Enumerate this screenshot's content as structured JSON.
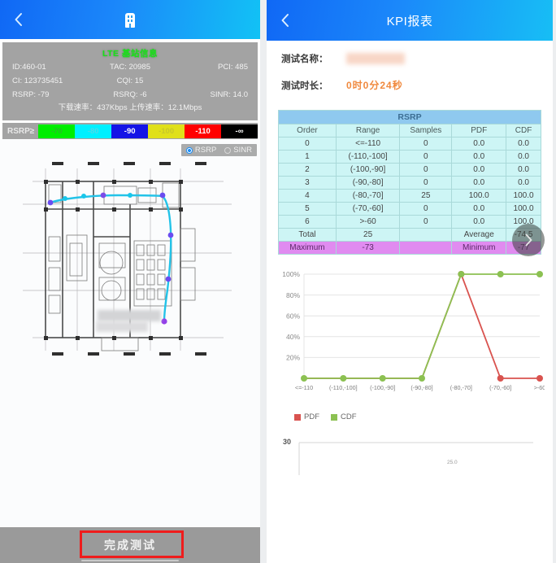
{
  "left": {
    "navbar": {
      "back_icon": "chevron-left-icon",
      "center_icon": "base-station-icon"
    },
    "cell_info": {
      "title": "LTE 基站信息",
      "id_label": "ID:460-01",
      "tac_label": "TAC: 20985",
      "pci_label": "PCI: 485",
      "ci_label": "CI: 123735451",
      "cqi_label": "CQI: 15",
      "blank_label": "",
      "rsrp_label": "RSRP: -79",
      "rsrq_label": "RSRQ: -6",
      "sinr_label": "SINR: 14.0",
      "rates_label": "下载速率：437Kbps 上传速率：12.1Mbps"
    },
    "legend": {
      "label": "RSRP≥",
      "cells": [
        {
          "text": "-70",
          "bg": "#00ee00",
          "fg": "#2bb82b"
        },
        {
          "text": "-80",
          "bg": "#00f0ff",
          "fg": "#4fd8e8"
        },
        {
          "text": "-90",
          "bg": "#1414e6",
          "fg": "#ffffff"
        },
        {
          "text": "-100",
          "bg": "#e0e01a",
          "fg": "#c8c82a"
        },
        {
          "text": "-110",
          "bg": "#ff0000",
          "fg": "#ffffff"
        },
        {
          "text": "-∞",
          "bg": "#000000",
          "fg": "#ffffff"
        }
      ]
    },
    "overlay_toggle": {
      "rsrp_label": "RSRP",
      "sinr_label": "SINR",
      "selected": "RSRP"
    },
    "map": {
      "scroll_hint": ""
    },
    "bottom": {
      "finish_label": "完成测试"
    }
  },
  "right": {
    "navbar": {
      "back_icon": "chevron-left-icon",
      "title": "KPI报表"
    },
    "meta": {
      "name_label": "测试名称：",
      "name_value": "",
      "duration_label": "测试时长：",
      "duration_value": "0时0分24秒"
    },
    "table": {
      "title": "RSRP",
      "headers": [
        "Order",
        "Range",
        "Samples",
        "PDF",
        "CDF"
      ],
      "rows": [
        [
          "0",
          "<=-110",
          "0",
          "0.0",
          "0.0"
        ],
        [
          "1",
          "(-110,-100]",
          "0",
          "0.0",
          "0.0"
        ],
        [
          "2",
          "(-100,-90]",
          "0",
          "0.0",
          "0.0"
        ],
        [
          "3",
          "(-90,-80]",
          "0",
          "0.0",
          "0.0"
        ],
        [
          "4",
          "(-80,-70]",
          "25",
          "100.0",
          "100.0"
        ],
        [
          "5",
          "(-70,-60]",
          "0",
          "0.0",
          "100.0"
        ],
        [
          "6",
          ">-60",
          "0",
          "0.0",
          "100.0"
        ]
      ],
      "summary": [
        "Total",
        "25",
        "",
        "Average",
        "-74.5"
      ],
      "minmax": [
        "Maximum",
        "-73",
        "",
        "Minimum",
        "-77"
      ]
    },
    "fab": {
      "icon": "chevron-right-icon"
    },
    "chart2": {
      "ytick": "30",
      "point_label": "25.0"
    }
  },
  "chart_data": {
    "type": "line",
    "title": "",
    "xlabel": "",
    "ylabel": "",
    "categories": [
      "<=-110",
      "(-110,-100]",
      "(-100,-90]",
      "(-90,-80]",
      "(-80,-70]",
      "(-70,-60]",
      ">-60"
    ],
    "series": [
      {
        "name": "PDF",
        "color": "#d9534f",
        "values": [
          0,
          0,
          0,
          0,
          100,
          0,
          0
        ]
      },
      {
        "name": "CDF",
        "color": "#8cc152",
        "values": [
          0,
          0,
          0,
          0,
          100,
          100,
          100
        ]
      }
    ],
    "ylim": [
      0,
      100
    ],
    "yticks": [
      20,
      40,
      60,
      80,
      100
    ],
    "ytick_labels": [
      "20%",
      "40%",
      "60%",
      "80%",
      "100%"
    ],
    "grid": true,
    "legend_position": "bottom-left"
  }
}
